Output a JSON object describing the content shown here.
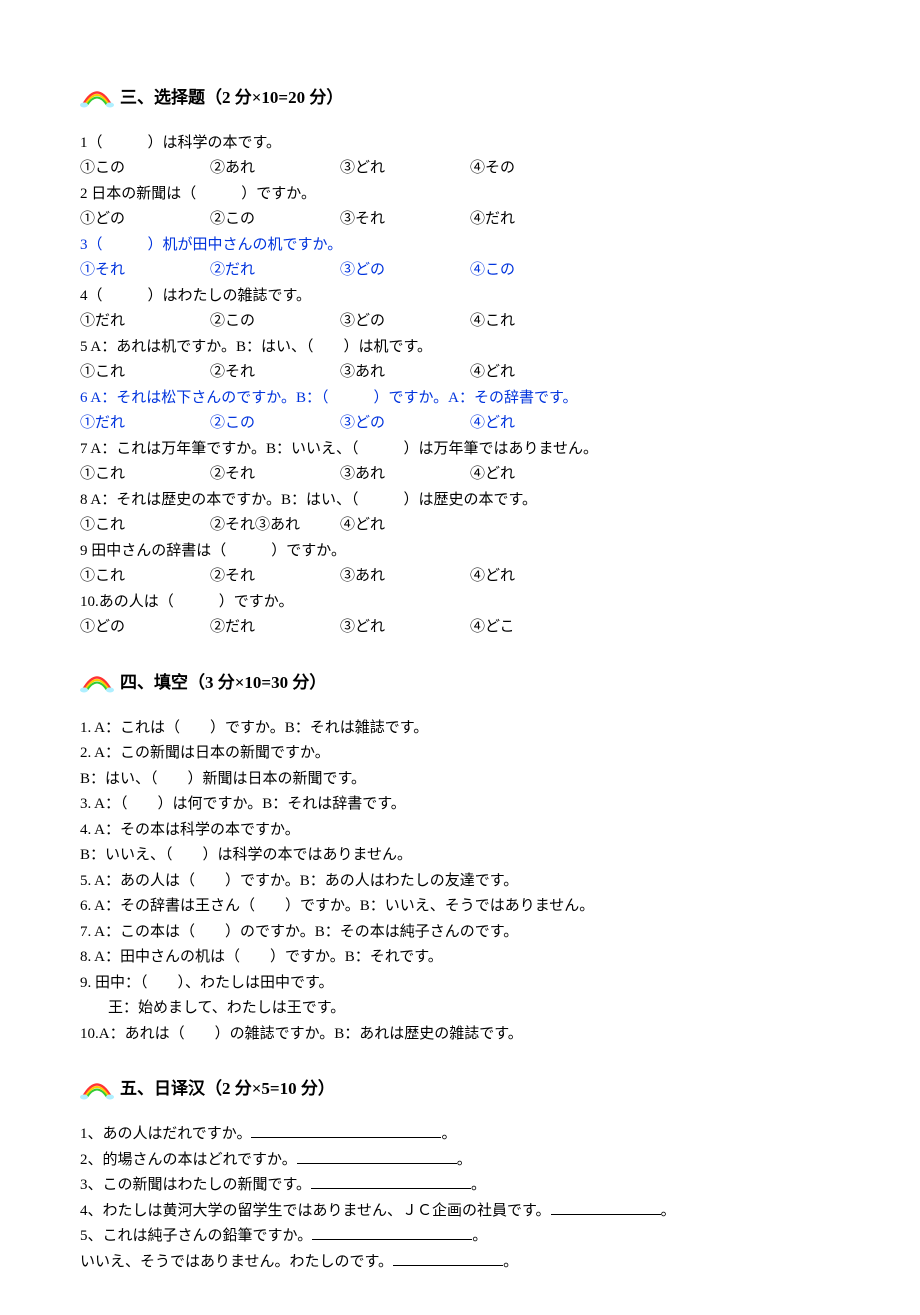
{
  "section3": {
    "title": "三、选择题（2 分×10=20 分）",
    "q1": {
      "text": "1（　　　）は科学の本です。",
      "o1": "①この",
      "o2": "②あれ",
      "o3": "③どれ",
      "o4": "④その"
    },
    "q2": {
      "text": "2 日本の新聞は（　　　）ですか。",
      "o1": "①どの",
      "o2": "②この",
      "o3": "③それ",
      "o4": "④だれ"
    },
    "q3": {
      "text": "3（　　　）机が田中さんの机ですか。",
      "o1": "①それ",
      "o2": "②だれ",
      "o3": "③どの",
      "o4": "④この"
    },
    "q4": {
      "text": "4（　　　）はわたしの雑誌です。",
      "o1": "①だれ",
      "o2": "②この",
      "o3": "③どの",
      "o4": "④これ"
    },
    "q5": {
      "text": "5 A：あれは机ですか。B：はい、（　　）は机です。",
      "o1": "①これ",
      "o2": "②それ",
      "o3": "③あれ",
      "o4": "④どれ"
    },
    "q6": {
      "text": "6 A：それは松下さんのですか。B：（　　　）ですか。A：その辞書です。",
      "o1": "①だれ",
      "o2": "②この",
      "o3": "③どの",
      "o4": "④どれ"
    },
    "q7": {
      "text": "7 A：これは万年筆ですか。B：いいえ、（　　　）は万年筆ではありません。",
      "o1": "①これ",
      "o2": "②それ",
      "o3": "③あれ",
      "o4": "④どれ"
    },
    "q8": {
      "text": "8 A：それは歴史の本ですか。B：はい、（　　　）は歴史の本です。",
      "o1": "①これ",
      "o2": "②それ③あれ",
      "o3": "④どれ",
      "o4": ""
    },
    "q9": {
      "text": "9  田中さんの辞書は（　　　）ですか。",
      "o1": "①これ",
      "o2": "②それ",
      "o3": "③あれ",
      "o4": "④どれ"
    },
    "q10": {
      "text": "10.あの人は（　　　）ですか。",
      "o1": "①どの",
      "o2": "②だれ",
      "o3": "③どれ",
      "o4": "④どこ"
    }
  },
  "section4": {
    "title": "四、填空（3 分×10=30 分）",
    "lines": {
      "l1": "1. A：これは（　　）ですか。B：それは雑誌です。",
      "l2": "2. A：この新聞は日本の新聞ですか。",
      "l2b": "B：はい、（　　）新聞は日本の新聞です。",
      "l3": "3. A：（　　）は何ですか。B：それは辞書です。",
      "l4": "4. A：その本は科学の本ですか。",
      "l4b": "B：いいえ、（　　）は科学の本ではありません。",
      "l5": "5. A：あの人は（　　）ですか。B：あの人はわたしの友達です。",
      "l6": "6. A：その辞書は王さん（　　）ですか。B：いいえ、そうではありません。",
      "l7": "7. A：この本は（　　）のですか。B：その本は純子さんのです。",
      "l8": "8. A：田中さんの机は（　　）ですか。B：それです。",
      "l9": "9.  田中：（　　）、わたしは田中です。",
      "l9b": "王：始めまして、わたしは王です。",
      "l10": "10.A：あれは（　　）の雑誌ですか。B：あれは歴史の雑誌です。"
    }
  },
  "section5": {
    "title": "五、日译汉（2 分×5=10 分）",
    "q1_a": "1、あの人はだれですか。",
    "q1_b": "。",
    "q2_a": "2、的場さんの本はどれですか。",
    "q2_b": "。",
    "q3_a": "3、この新聞はわたしの新聞です。",
    "q3_b": "。",
    "q4_a": "4、わたしは黄河大学の留学生ではありません、ＪＣ企画の社員です。",
    "q4_b": "。",
    "q5_a": "5、これは純子さんの鉛筆ですか。",
    "q5_b": "。",
    "q5c_a": "いいえ、そうではありません。わたしのです。",
    "q5c_b": "。"
  }
}
